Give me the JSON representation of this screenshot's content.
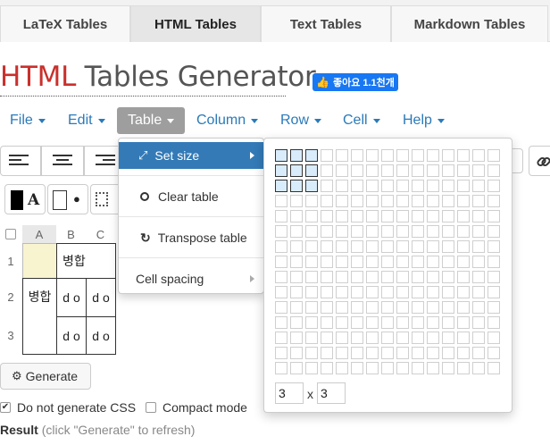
{
  "top_tabs": [
    "LaTeX Tables",
    "HTML Tables",
    "Text Tables",
    "Markdown Tables"
  ],
  "title": {
    "part1": "HTML",
    "part2": " Tables Generator"
  },
  "fb_like": "좋아요 1.1천개",
  "menu": [
    "File",
    "Edit",
    "Table",
    "Column",
    "Row",
    "Cell",
    "Help"
  ],
  "table_menu": {
    "set_size": "Set size",
    "clear_table": "Clear table",
    "transpose_table": "Transpose table",
    "cell_spacing": "Cell spacing"
  },
  "size_picker": {
    "rows_selected": 3,
    "cols_selected": 3,
    "rows_value": "3",
    "cols_value": "3",
    "times": "x"
  },
  "grid": {
    "col_headers": [
      "A",
      "B",
      "C"
    ],
    "row_headers": [
      "1",
      "2",
      "3"
    ],
    "merged_top": "병합",
    "merged_left": "병합",
    "cells": [
      "d o",
      "d o",
      "d o",
      "d o"
    ]
  },
  "generate_label": "Generate",
  "options": {
    "no_css": "Do not generate CSS",
    "compact": "Compact mode"
  },
  "result": {
    "label": "Result",
    "hint": "(click \"Generate\" to refresh)"
  },
  "colors": {
    "accent": "#337ab7",
    "title_red": "#c9302c",
    "selected_cell": "#f8f4d0"
  }
}
